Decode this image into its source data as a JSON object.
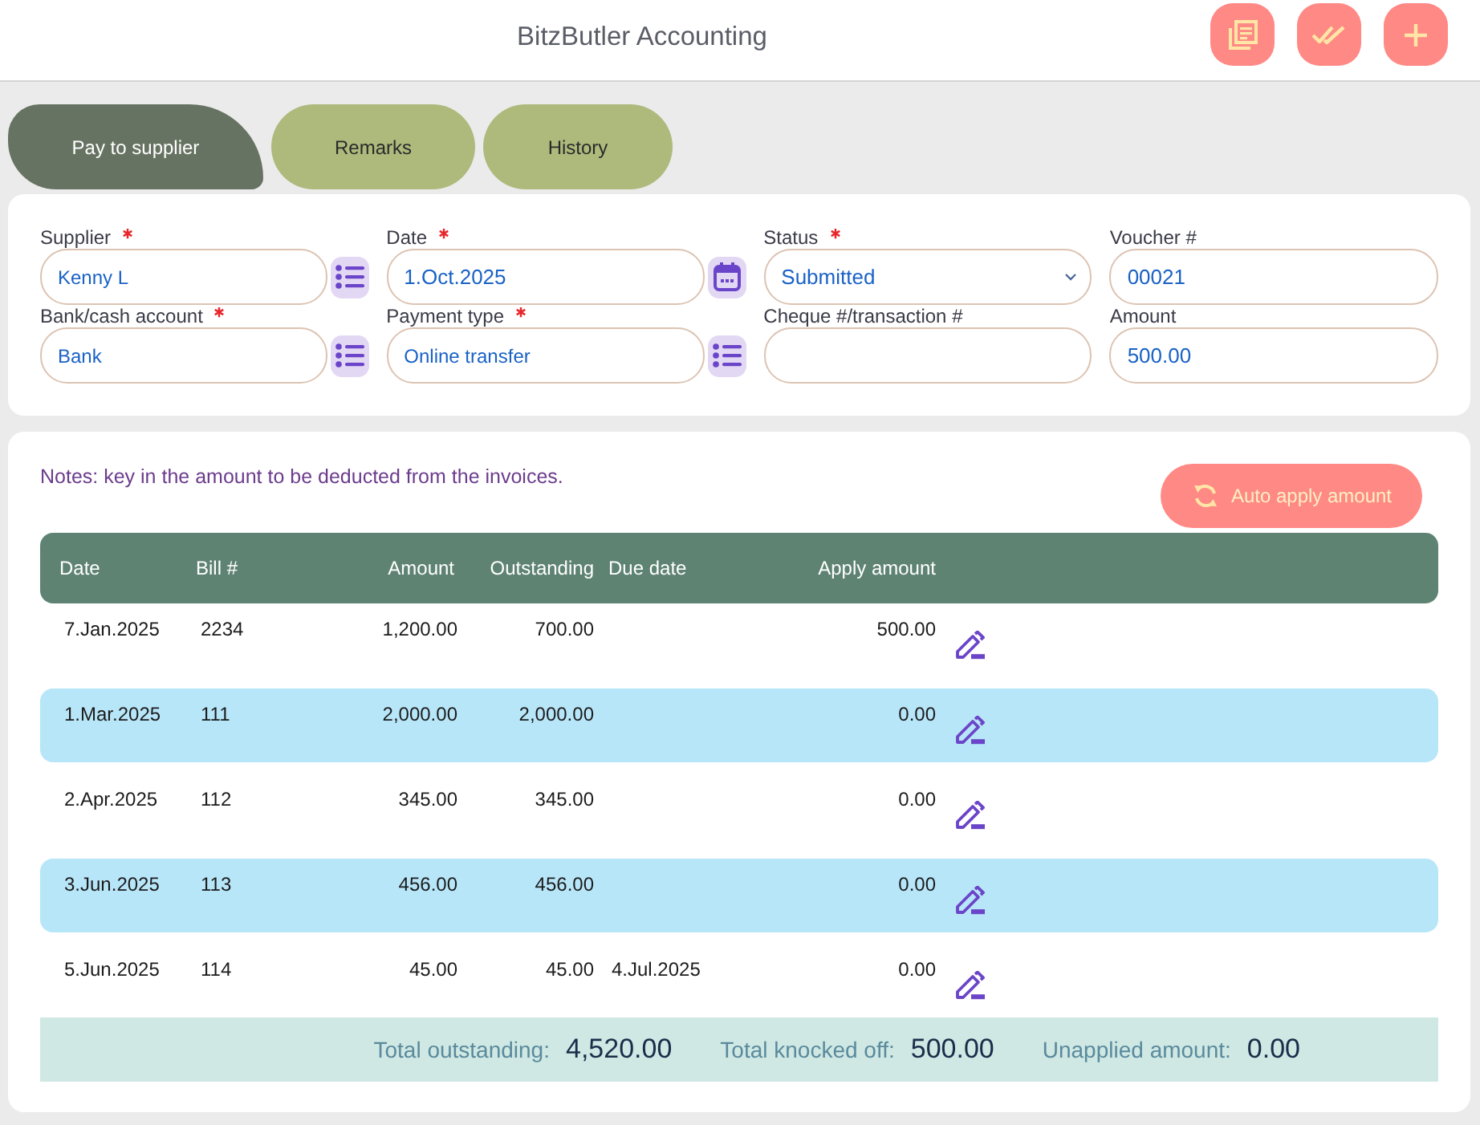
{
  "header": {
    "title": "BitzButler Accounting"
  },
  "tabs": [
    {
      "label": "Pay to supplier",
      "selected": true
    },
    {
      "label": "Remarks",
      "selected": false
    },
    {
      "label": "History",
      "selected": false
    }
  ],
  "form": {
    "fields": [
      {
        "label": "Supplier",
        "required": true,
        "kind": "list",
        "value": "Kenny L"
      },
      {
        "label": "Date",
        "required": true,
        "kind": "date",
        "value": "1.Oct.2025"
      },
      {
        "label": "Status",
        "required": true,
        "kind": "select",
        "value": "Submitted"
      },
      {
        "label": "Voucher #",
        "required": false,
        "kind": "text",
        "value": "00021"
      },
      {
        "label": "Bank/cash account",
        "required": true,
        "kind": "list",
        "value": "Bank"
      },
      {
        "label": "Payment type",
        "required": true,
        "kind": "list",
        "value": "Online transfer"
      },
      {
        "label": "Cheque #/transaction #",
        "required": false,
        "kind": "text"
      },
      {
        "label": "Amount",
        "required": false,
        "kind": "text",
        "value": "500.00"
      }
    ]
  },
  "allocation": {
    "note": "Notes: key in the amount to be deducted from the invoices.",
    "auto_apply_button": "Auto apply amount",
    "table": {
      "columns": [
        "Date",
        "Bill #",
        "Amount",
        "Outstanding",
        "Due date",
        "Apply amount"
      ],
      "rows": [
        {
          "date": "7.Jan.2025",
          "bill": "2234",
          "amount": "1,200.00",
          "outstanding": "700.00",
          "apply_amount": "500.00"
        },
        {
          "date": "1.Mar.2025",
          "bill": "111",
          "amount": "2,000.00",
          "outstanding": "2,000.00",
          "apply_amount": "0.00"
        },
        {
          "date": "2.Apr.2025",
          "bill": "112",
          "amount": "345.00",
          "outstanding": "345.00",
          "apply_amount": "0.00"
        },
        {
          "date": "3.Jun.2025",
          "bill": "113",
          "amount": "456.00",
          "outstanding": "456.00",
          "apply_amount": "0.00"
        },
        {
          "date": "5.Jun.2025",
          "bill": "114",
          "amount": "45.00",
          "outstanding": "45.00",
          "due_date": "4.Jul.2025",
          "apply_amount": "0.00"
        }
      ]
    },
    "totals": [
      {
        "label": "Total outstanding:",
        "value": "4,520.00"
      },
      {
        "label": "Total knocked off:",
        "value": "500.00"
      },
      {
        "label": "Unapplied amount:",
        "value": "0.00"
      }
    ]
  }
}
